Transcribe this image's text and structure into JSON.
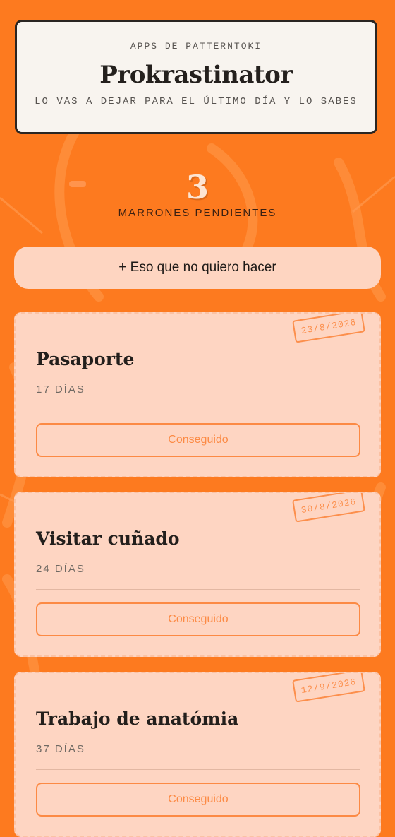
{
  "header": {
    "kicker": "APPS DE PATTERNTOKI",
    "title": "Prokrastinator",
    "tagline": "LO VAS A DEJAR PARA EL ÚLTIMO DÍA Y LO SABES"
  },
  "counter": {
    "number": "3",
    "label": "MARRONES PENDIENTES"
  },
  "add_button": {
    "label": "+ Eso que no quiero hacer"
  },
  "tasks": [
    {
      "title": "Pasaporte",
      "days": "17 DÍAS",
      "date": "23/8/2026",
      "button": "Conseguido"
    },
    {
      "title": "Visitar cuñado",
      "days": "24 DÍAS",
      "date": "30/8/2026",
      "button": "Conseguido"
    },
    {
      "title": "Trabajo de anatómia",
      "days": "37 DÍAS",
      "date": "12/9/2026",
      "button": "Conseguido"
    }
  ],
  "colors": {
    "background": "#fd7a1f",
    "card": "#fed5c2",
    "accent": "#fc8a44",
    "header_bg": "#f8f4ef"
  }
}
